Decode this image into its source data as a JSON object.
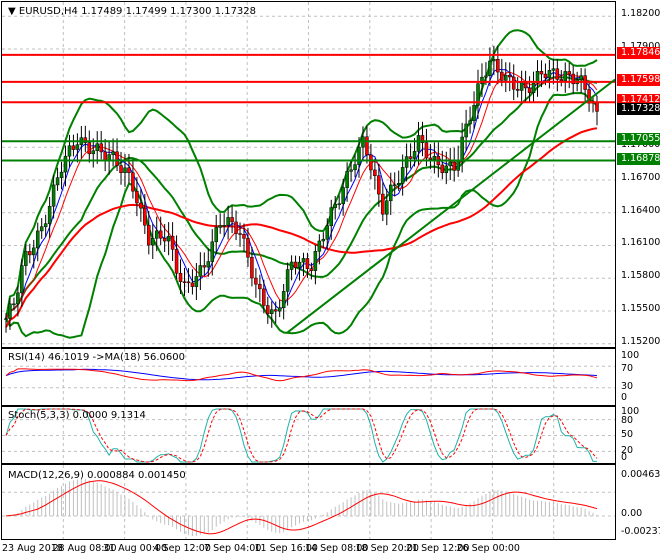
{
  "chart": {
    "symbol_line": "EURUSD,H4  1.17489 1.17499 1.17300 1.17328"
  },
  "price_axis": {
    "labels": [
      "1.18200",
      "1.17900",
      "1.17000",
      "1.16700",
      "1.16400",
      "1.16100",
      "1.15800",
      "1.15500",
      "1.15200"
    ],
    "values": [
      1.182,
      1.179,
      1.17,
      1.167,
      1.164,
      1.161,
      1.158,
      1.155,
      1.152
    ],
    "range": [
      1.1517,
      1.1833
    ]
  },
  "levels": [
    {
      "label": "1.17846",
      "value": 1.17846,
      "color": "#ff0000"
    },
    {
      "label": "1.17598",
      "value": 1.17598,
      "color": "#ff0000"
    },
    {
      "label": "1.17412",
      "value": 1.17412,
      "color": "#ff0000"
    },
    {
      "label": "1.17055",
      "value": 1.17055,
      "color": "#008000"
    },
    {
      "label": "1.16878",
      "value": 1.16878,
      "color": "#008000"
    }
  ],
  "current_price": {
    "label": "1.17328",
    "value": 1.17328,
    "color": "#000000"
  },
  "trendline": {
    "from": 1.153,
    "to": 1.1762,
    "color": "#008000"
  },
  "closes": [
    1.1543,
    1.156,
    1.1597,
    1.161,
    1.1625,
    1.165,
    1.168,
    1.1695,
    1.1707,
    1.17,
    1.1698,
    1.1694,
    1.169,
    1.168,
    1.167,
    1.164,
    1.1615,
    1.1618,
    1.162,
    1.159,
    1.157,
    1.158,
    1.1588,
    1.161,
    1.1634,
    1.163,
    1.1625,
    1.16,
    1.157,
    1.1555,
    1.1543,
    1.157,
    1.1597,
    1.1593,
    1.159,
    1.161,
    1.1634,
    1.165,
    1.167,
    1.169,
    1.1707,
    1.1675,
    1.1643,
    1.166,
    1.1675,
    1.169,
    1.1707,
    1.1695,
    1.1684,
    1.1682,
    1.168,
    1.1707,
    1.1734,
    1.176,
    1.1779,
    1.177,
    1.1761,
    1.1756,
    1.1752,
    1.176,
    1.177,
    1.1767,
    1.1765,
    1.1764,
    1.1763,
    1.1748,
    1.1733
  ],
  "rsi": {
    "title": "RSI(14) 46.1019  ->MA(18) 56.0600",
    "levels": [
      "100",
      "70",
      "30",
      "0"
    ],
    "colors": {
      "rsi": "#ff0000",
      "ma": "#0000ff"
    }
  },
  "stoch": {
    "title": "Stoch(5,3,3) 0.0000 9.1314",
    "levels": [
      "100",
      "80",
      "50",
      "20",
      "0"
    ],
    "colors": {
      "main": "#20b2aa",
      "signal": "#ff0000"
    }
  },
  "macd": {
    "title": "MACD(12,26,9) 0.000884 0.001450",
    "levels": [
      "0.004639",
      "0.00",
      "-0.002379"
    ],
    "colors": {
      "hist": "#c0c0c0",
      "signal": "#ff0000"
    }
  },
  "time_axis": [
    "23 Aug 2018",
    "28 Aug 08:00",
    "31 Aug 00:00",
    "4 Sep 12:00",
    "7 Sep 04:00",
    "11 Sep 16:00",
    "14 Sep 08:00",
    "18 Sep 20:00",
    "21 Sep 12:00",
    "26 Sep 00:00"
  ]
}
